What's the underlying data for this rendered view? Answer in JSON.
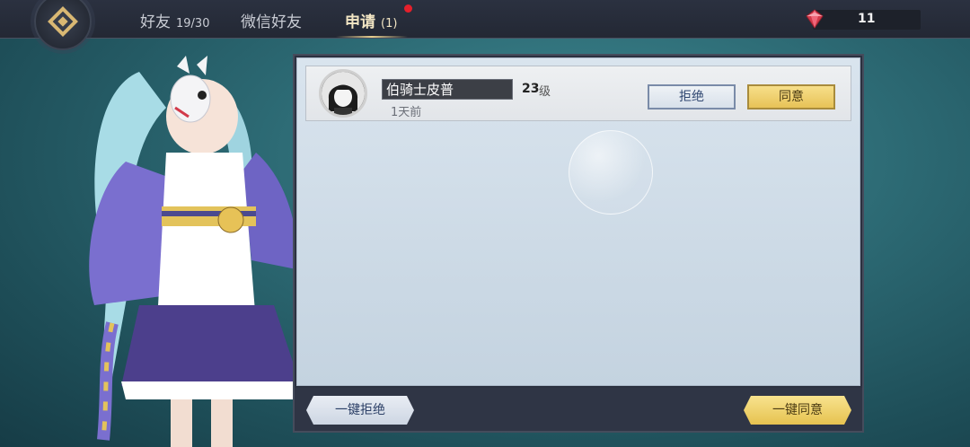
{
  "header": {
    "tabs": [
      {
        "label": "好友",
        "count": "19/30",
        "active": false
      },
      {
        "label": "微信好友",
        "count": "",
        "active": false
      },
      {
        "label": "申请",
        "count": "(1)",
        "active": true
      }
    ],
    "currency": {
      "icon": "red-gem-icon",
      "value": "11"
    }
  },
  "requests": [
    {
      "name": "伯骑士皮普",
      "level": "23",
      "level_unit": "级",
      "time": "1天前",
      "reject_label": "拒绝",
      "accept_label": "同意"
    }
  ],
  "footer": {
    "reject_all_label": "一键拒绝",
    "accept_all_label": "一键同意"
  },
  "colors": {
    "accent_gold": "#e7c257",
    "notification_red": "#e5202b"
  }
}
